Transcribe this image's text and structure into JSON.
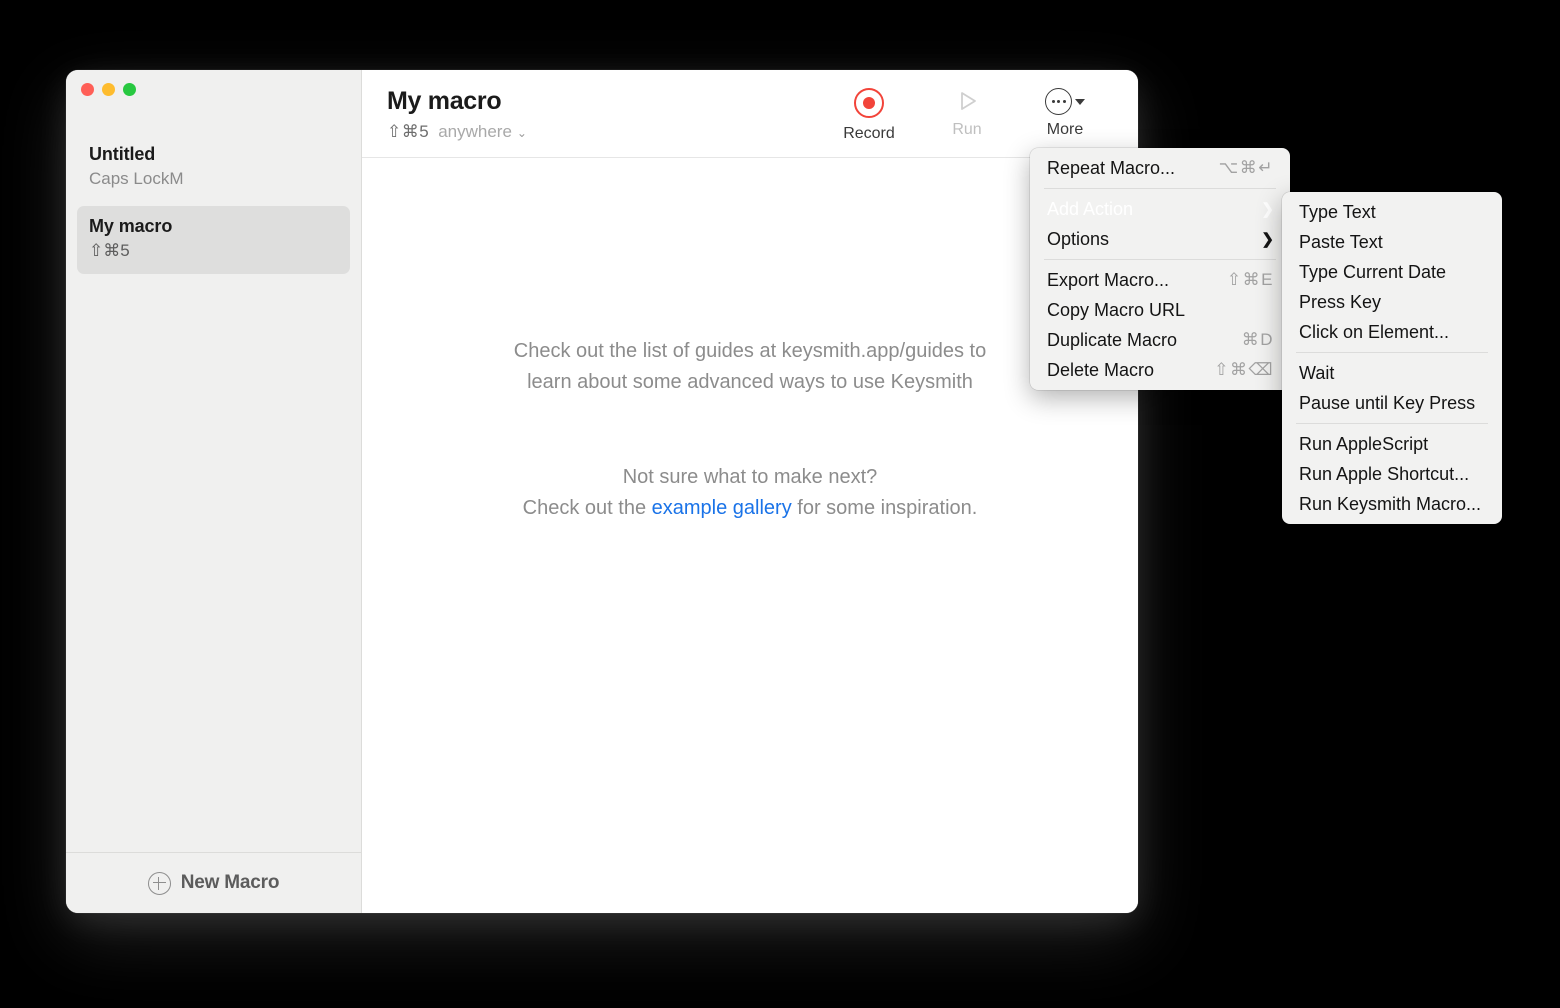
{
  "window": {
    "traffic_lights": [
      "close",
      "minimize",
      "zoom"
    ],
    "colors": {
      "close": "#ff5f57",
      "minimize": "#febc2e",
      "zoom": "#28c840",
      "record": "#f2443a",
      "link": "#1a73e8",
      "selection": "#dededd"
    }
  },
  "sidebar": {
    "macros": [
      {
        "name": "Untitled",
        "shortcut": "Caps LockM",
        "selected": false
      },
      {
        "name": "My macro",
        "shortcut": "⇧⌘5",
        "selected": true
      }
    ],
    "new_macro_label": "New Macro"
  },
  "header": {
    "title": "My macro",
    "shortcut": "⇧⌘5",
    "scope": "anywhere"
  },
  "toolbar": {
    "record_label": "Record",
    "run_label": "Run",
    "more_label": "More"
  },
  "content": {
    "hint1_line1": "Check out the list of guides at keysmith.app/guides to",
    "hint1_line2": "learn about some advanced ways to use Keysmith",
    "hint2_line1": "Not sure what to make next?",
    "hint2_prefix": "Check out the ",
    "hint2_link": "example gallery",
    "hint2_suffix": " for some inspiration."
  },
  "more_menu": {
    "items": [
      {
        "label": "Repeat Macro...",
        "shortcut": "⌥⌘↵",
        "arrow": "",
        "dim": false
      },
      {
        "sep": true
      },
      {
        "label": "Add Action",
        "shortcut": "",
        "arrow": "❯",
        "dim": true
      },
      {
        "label": "Options",
        "shortcut": "",
        "arrow": "❯",
        "dim": false
      },
      {
        "sep": true
      },
      {
        "label": "Export Macro...",
        "shortcut": "⇧⌘E",
        "arrow": "",
        "dim": false
      },
      {
        "label": "Copy Macro URL",
        "shortcut": "",
        "arrow": "",
        "dim": false
      },
      {
        "label": "Duplicate Macro",
        "shortcut": "⌘D",
        "arrow": "",
        "dim": false
      },
      {
        "label": "Delete Macro",
        "shortcut": "⇧⌘⌫",
        "arrow": "",
        "dim": false
      }
    ]
  },
  "add_action_submenu": {
    "items": [
      {
        "label": "Type Text"
      },
      {
        "label": "Paste Text"
      },
      {
        "label": "Type Current Date"
      },
      {
        "label": "Press Key"
      },
      {
        "label": "Click on Element..."
      },
      {
        "sep": true
      },
      {
        "label": "Wait"
      },
      {
        "label": "Pause until Key Press"
      },
      {
        "sep": true
      },
      {
        "label": "Run AppleScript"
      },
      {
        "label": "Run Apple Shortcut..."
      },
      {
        "label": "Run Keysmith Macro..."
      }
    ]
  }
}
